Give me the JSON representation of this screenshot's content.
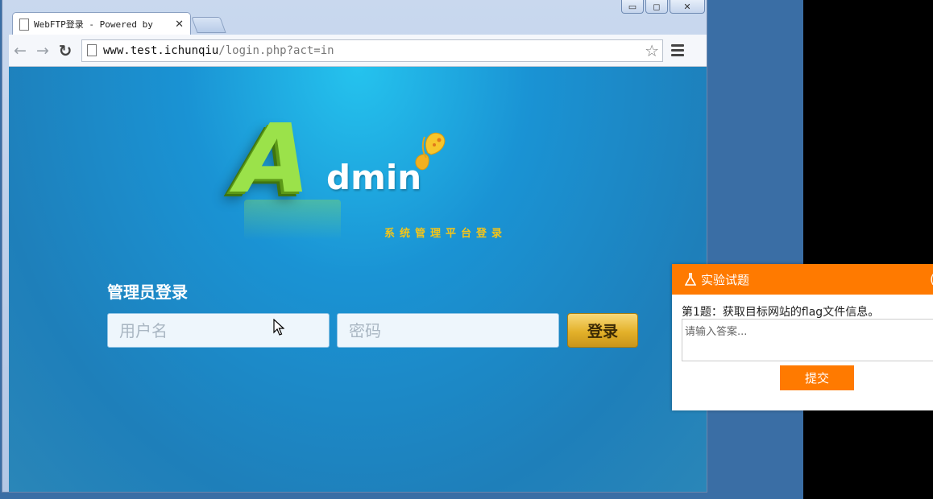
{
  "browser": {
    "tab_title": "WebFTP登录 - Powered by",
    "url_host": "www.test.ichunqiu",
    "url_path": "/login.php?act=in"
  },
  "window_controls": {
    "minimize": "▭",
    "maximize": "◻",
    "close": "✕"
  },
  "page": {
    "logo_letter": "A",
    "logo_word": "dmin",
    "subtitle": "系统管理平台登录",
    "login_title": "管理员登录",
    "username_placeholder": "用户名",
    "password_placeholder": "密码",
    "login_button": "登录"
  },
  "task_panel": {
    "header": "实验试题",
    "question": "第1题：获取目标网站的flag文件信息。",
    "answer_placeholder": "请输入答案...",
    "submit_button": "提交",
    "accent_color": "#ff7a00"
  },
  "icons": [
    "page-icon",
    "back-arrow-icon",
    "forward-arrow-icon",
    "reload-icon",
    "star-icon",
    "menu-icon",
    "butterfly-icon",
    "flask-icon",
    "mouse-cursor-icon"
  ]
}
